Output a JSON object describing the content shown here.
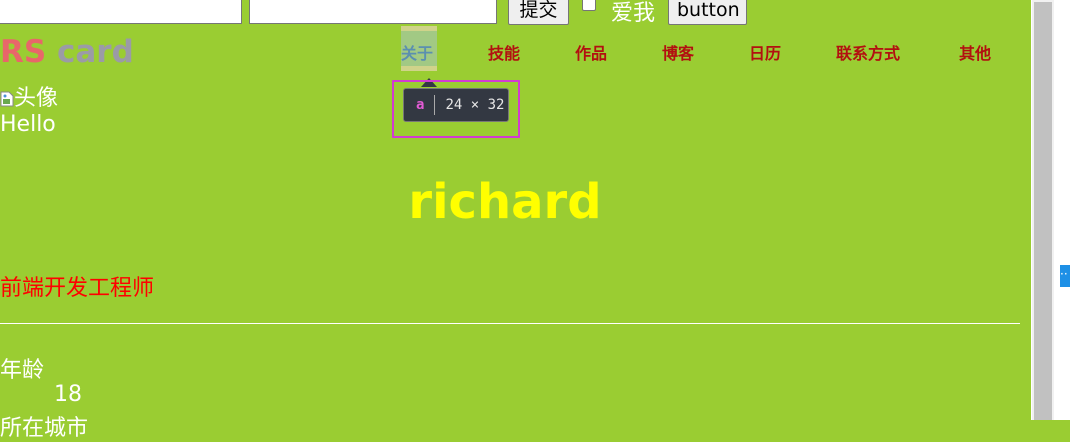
{
  "form": {
    "input1_value": "",
    "input2_value": "",
    "submit_label": "提交",
    "checkbox_label": "爱我",
    "button_label": "button"
  },
  "header": {
    "logo_rs": "RS",
    "logo_card": "card",
    "nav": [
      "关于",
      "技能",
      "作品",
      "博客",
      "日历",
      "联系方式",
      "其他"
    ]
  },
  "inspector": {
    "tag": "a",
    "size": "24 × 32"
  },
  "profile": {
    "avatar_alt": "头像",
    "greeting": "Hello",
    "name": "richard",
    "role": "前端开发工程师",
    "age_label": "年龄",
    "age_value": "18",
    "city_label": "所在城市"
  },
  "colors": {
    "background": "#9acd32",
    "nav_text": "#b21010",
    "name": "#ffff00",
    "role": "#ff0000",
    "inspector_highlight": "#d23bd2"
  },
  "icons": {
    "avatar": "broken-image-icon"
  }
}
